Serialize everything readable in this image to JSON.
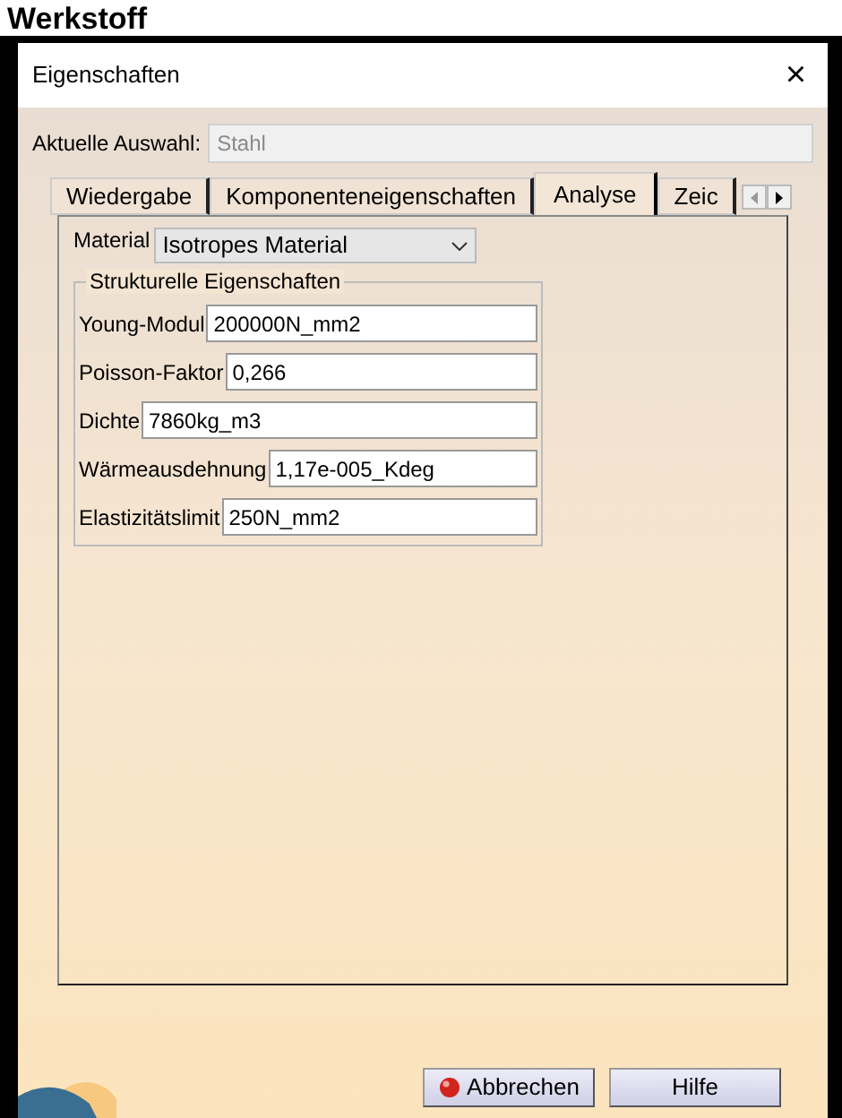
{
  "heading": "Werkstoff",
  "window": {
    "title": "Eigenschaften",
    "close": "×"
  },
  "selection": {
    "label": "Aktuelle Auswahl:",
    "value": "Stahl"
  },
  "tabs": [
    {
      "label": "Wiedergabe",
      "selected": false
    },
    {
      "label": "Komponenteneigenschaften",
      "selected": false
    },
    {
      "label": "Analyse",
      "selected": true
    },
    {
      "label": "Zeic",
      "selected": false
    }
  ],
  "material": {
    "label": "Material",
    "value": "Isotropes Material"
  },
  "group": {
    "title": "Strukturelle Eigenschaften",
    "fields": [
      {
        "label": "Young-Modul",
        "value": "200000N_mm2"
      },
      {
        "label": "Poisson-Faktor",
        "value": "0,266"
      },
      {
        "label": "Dichte",
        "value": "7860kg_m3"
      },
      {
        "label": "Wärmeausdehnung",
        "value": "1,17e-005_Kdeg"
      },
      {
        "label": "Elastizitätslimit",
        "value": "250N_mm2"
      }
    ]
  },
  "buttons": [
    {
      "label": "Abbrechen",
      "kind": "cancel"
    },
    {
      "label": "Hilfe",
      "kind": "plain"
    }
  ]
}
